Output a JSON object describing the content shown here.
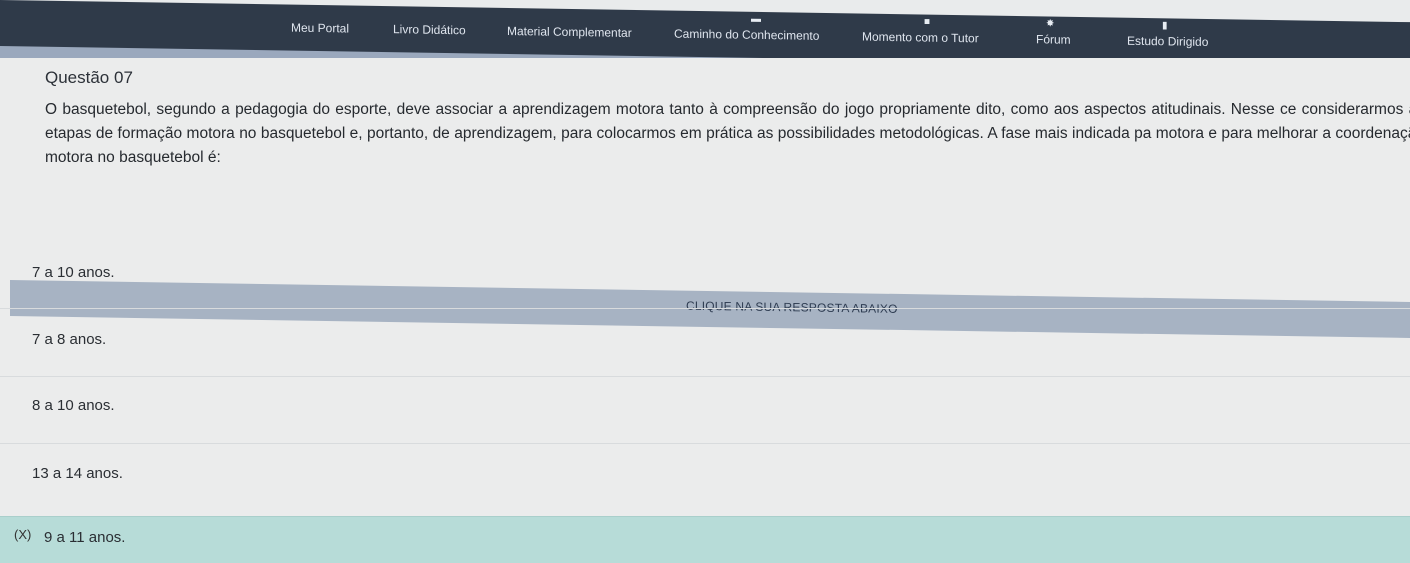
{
  "nav": {
    "items": [
      {
        "label": "Meu Portal",
        "icon": "home-icon"
      },
      {
        "label": "Livro Didático",
        "icon": "book-icon"
      },
      {
        "label": "Material Complementar",
        "icon": "folder-icon"
      },
      {
        "label": "Caminho do Conhecimento",
        "icon": "path-icon"
      },
      {
        "label": "Momento com o Tutor",
        "icon": "video-icon"
      },
      {
        "label": "Fórum",
        "icon": "users-icon"
      },
      {
        "label": "Estudo Dirigido",
        "icon": "document-icon"
      }
    ]
  },
  "question": {
    "title": "Questão 07",
    "text": "O basquetebol, segundo a pedagogia do esporte, deve associar a aprendizagem motora tanto à compreensão do jogo propriamente dito, como aos aspectos atitudinais. Nesse ce considerarmos as etapas de formação motora no basquetebol e, portanto, de aprendizagem, para colocarmos em prática as possibilidades metodológicas. A fase mais indicada pa motora e para melhorar a coordenação motora no basquetebol é:"
  },
  "answers": {
    "header": "CLIQUE NA SUA RESPOSTA ABAIXO",
    "options": [
      {
        "label": "7 a 10 anos.",
        "mark": ""
      },
      {
        "label": "7 a 8 anos.",
        "mark": ""
      },
      {
        "label": "8 a 10 anos.",
        "mark": ""
      },
      {
        "label": "13 a 14 anos.",
        "mark": ""
      },
      {
        "label": "9 a 11 anos.",
        "mark": "(X)"
      }
    ],
    "selected_index": 4
  },
  "colors": {
    "nav_bg": "#2f3a49",
    "header_bar": "#a7b3c3",
    "selected_bg": "#b7dcd8"
  }
}
